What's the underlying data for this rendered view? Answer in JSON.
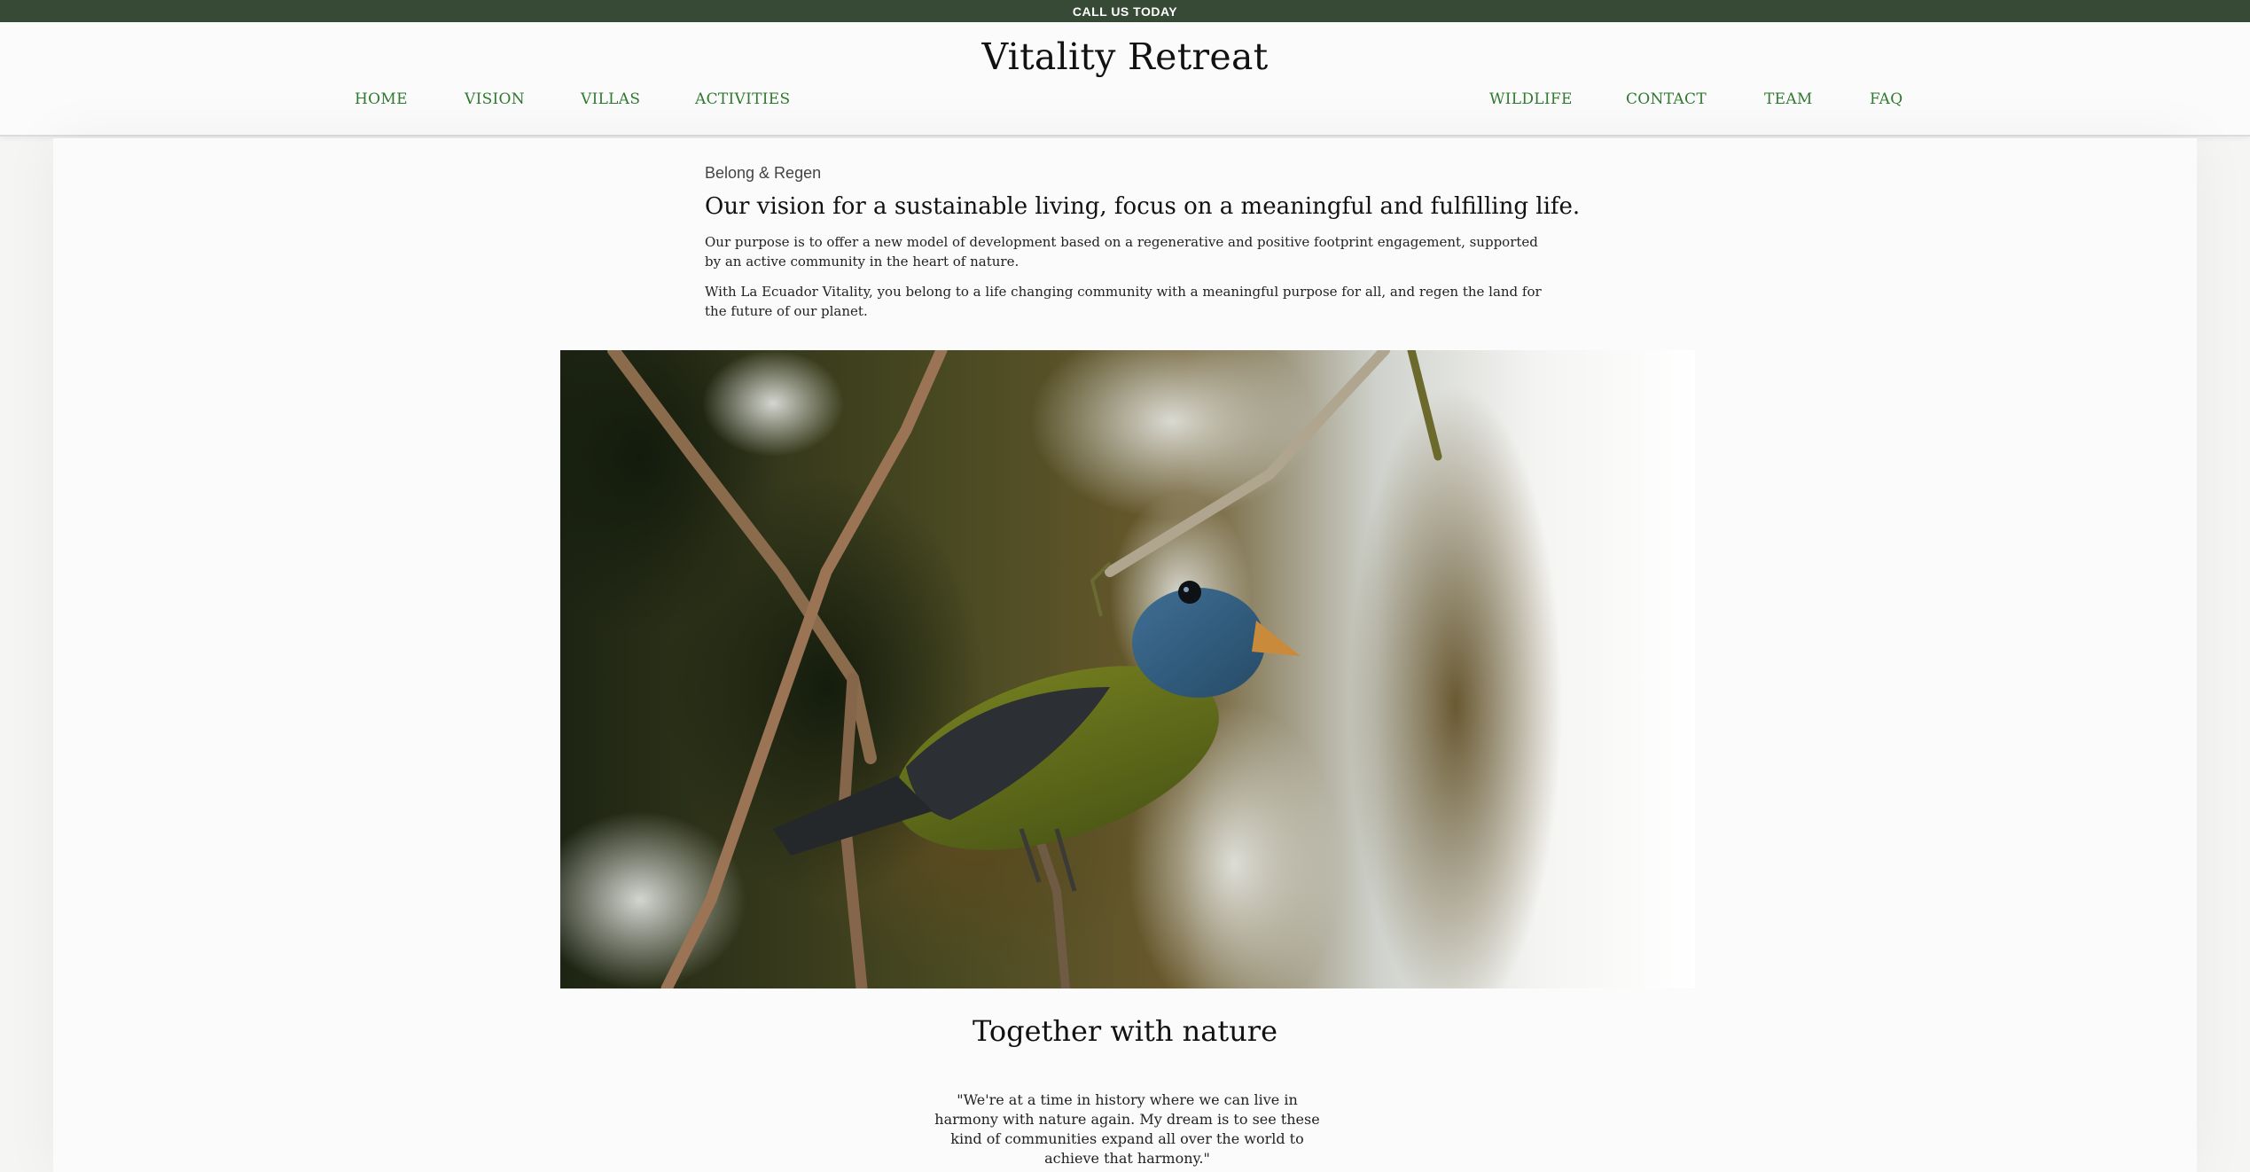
{
  "topbar": {
    "call_label": "CALL US TODAY"
  },
  "header": {
    "site_title": "Vitality Retreat",
    "nav_left": [
      "HOME",
      "VISION",
      "VILLAS",
      "ACTIVITIES"
    ],
    "nav_right": [
      "WILDLIFE",
      "CONTACT",
      "TEAM",
      "FAQ"
    ]
  },
  "intro": {
    "eyebrow": "Belong & Regen",
    "heading": "Our vision for a sustainable living, focus on a meaningful and fulfilling life.",
    "paragraph_1": "Our purpose is to offer a new model of development based on a regenerative and positive footprint engagement, supported by an active community in the heart of nature.",
    "paragraph_2": "With La Ecuador Vitality, you belong to a life changing community with a meaningful purpose for all, and regen the land for the future of our planet."
  },
  "hero": {
    "image": "bird-on-branch-photo"
  },
  "section": {
    "title": "Together with nature",
    "quote": "\"We're at a time in history where we can live in harmony with nature again. My dream is to see these kind of communities expand all over the world to achieve that harmony.\""
  },
  "colors": {
    "topbar_bg": "#374a36",
    "nav_link": "#2f7a2f",
    "page_bg": "#fbfbfb"
  }
}
